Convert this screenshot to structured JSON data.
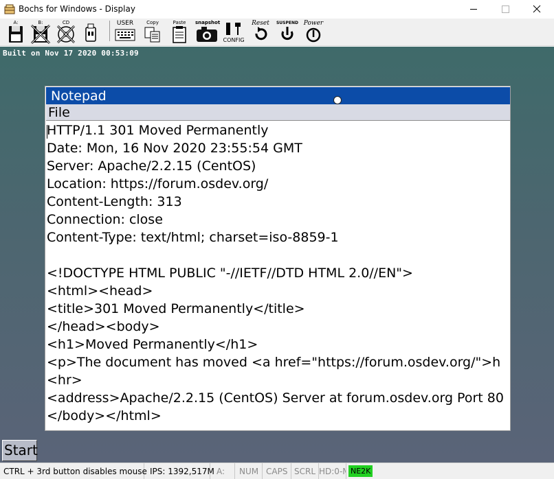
{
  "window": {
    "title": "Bochs for Windows - Display",
    "controls": {
      "minimize": "minimize",
      "maximize": "maximize",
      "close": "close"
    }
  },
  "toolbar": {
    "floppy_a": {
      "label": "A:",
      "icon": "floppy-icon"
    },
    "floppy_b": {
      "label": "B:",
      "icon": "floppy-disabled-icon"
    },
    "cdrom": {
      "label": "CD",
      "icon": "cdrom-disabled-icon"
    },
    "usb": {
      "label": "",
      "icon": "usb-icon"
    },
    "user": {
      "label": "USER",
      "icon": "keyboard-icon"
    },
    "copy": {
      "label": "Copy",
      "icon": "copy-icon"
    },
    "paste": {
      "label": "Paste",
      "icon": "paste-icon"
    },
    "snapshot": {
      "label": "snapshot",
      "icon": "camera-icon"
    },
    "config": {
      "label": "CONFIG",
      "icon": "config-icon"
    },
    "reset": {
      "label": "Reset",
      "icon": "reset-icon"
    },
    "suspend": {
      "label": "SUSPEND",
      "icon": "suspend-icon"
    },
    "power": {
      "label": "Power",
      "icon": "power-icon"
    }
  },
  "guest": {
    "built_text": "Built on Nov 17 2020 00:53:09",
    "notepad": {
      "title": "Notepad",
      "menu": {
        "file": "File"
      },
      "lines": [
        "HTTP/1.1 301 Moved Permanently",
        "Date: Mon, 16 Nov 2020 23:55:54 GMT",
        "Server: Apache/2.2.15 (CentOS)",
        "Location: https://forum.osdev.org/",
        "Content-Length: 313",
        "Connection: close",
        "Content-Type: text/html; charset=iso-8859-1",
        "",
        "<!DOCTYPE HTML PUBLIC \"-//IETF//DTD HTML 2.0//EN\">",
        "<html><head>",
        "<title>301 Moved Permanently</title>",
        "</head><body>",
        "<h1>Moved Permanently</h1>",
        "<p>The document has moved <a href=\"https://forum.osdev.org/\">h",
        "<hr>",
        "<address>Apache/2.2.15 (CentOS) Server at forum.osdev.org Port 80",
        "</body></html>"
      ]
    },
    "start_label": "Start"
  },
  "statusbar": {
    "hint": "CTRL + 3rd button disables mouse",
    "ips": "IPS: 1392,517M",
    "drive_a": "A:",
    "num": "NUM",
    "caps": "CAPS",
    "scrl": "SCRL",
    "hd": "HD:0-M",
    "ne2k": "NE2K"
  },
  "colors": {
    "notepad_titlebar": "#0c4ca8",
    "ne2k_active": "#22d022",
    "desktop_top": "#3f6a6a",
    "desktop_bottom": "#5a6478"
  }
}
